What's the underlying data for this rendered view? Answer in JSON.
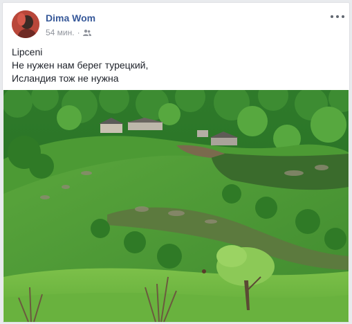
{
  "post": {
    "author": "Dima Wom",
    "timestamp": "54 мин.",
    "separator": "·",
    "audience_icon": "friends-icon",
    "more_icon": "more-options-icon",
    "text_lines": [
      "Lipceni",
      "Не нужен нам берег турецкий,",
      "Исландия тож не нужна"
    ]
  },
  "colors": {
    "author_link": "#365899",
    "meta_text": "#90949c",
    "body_text": "#1d2129"
  }
}
